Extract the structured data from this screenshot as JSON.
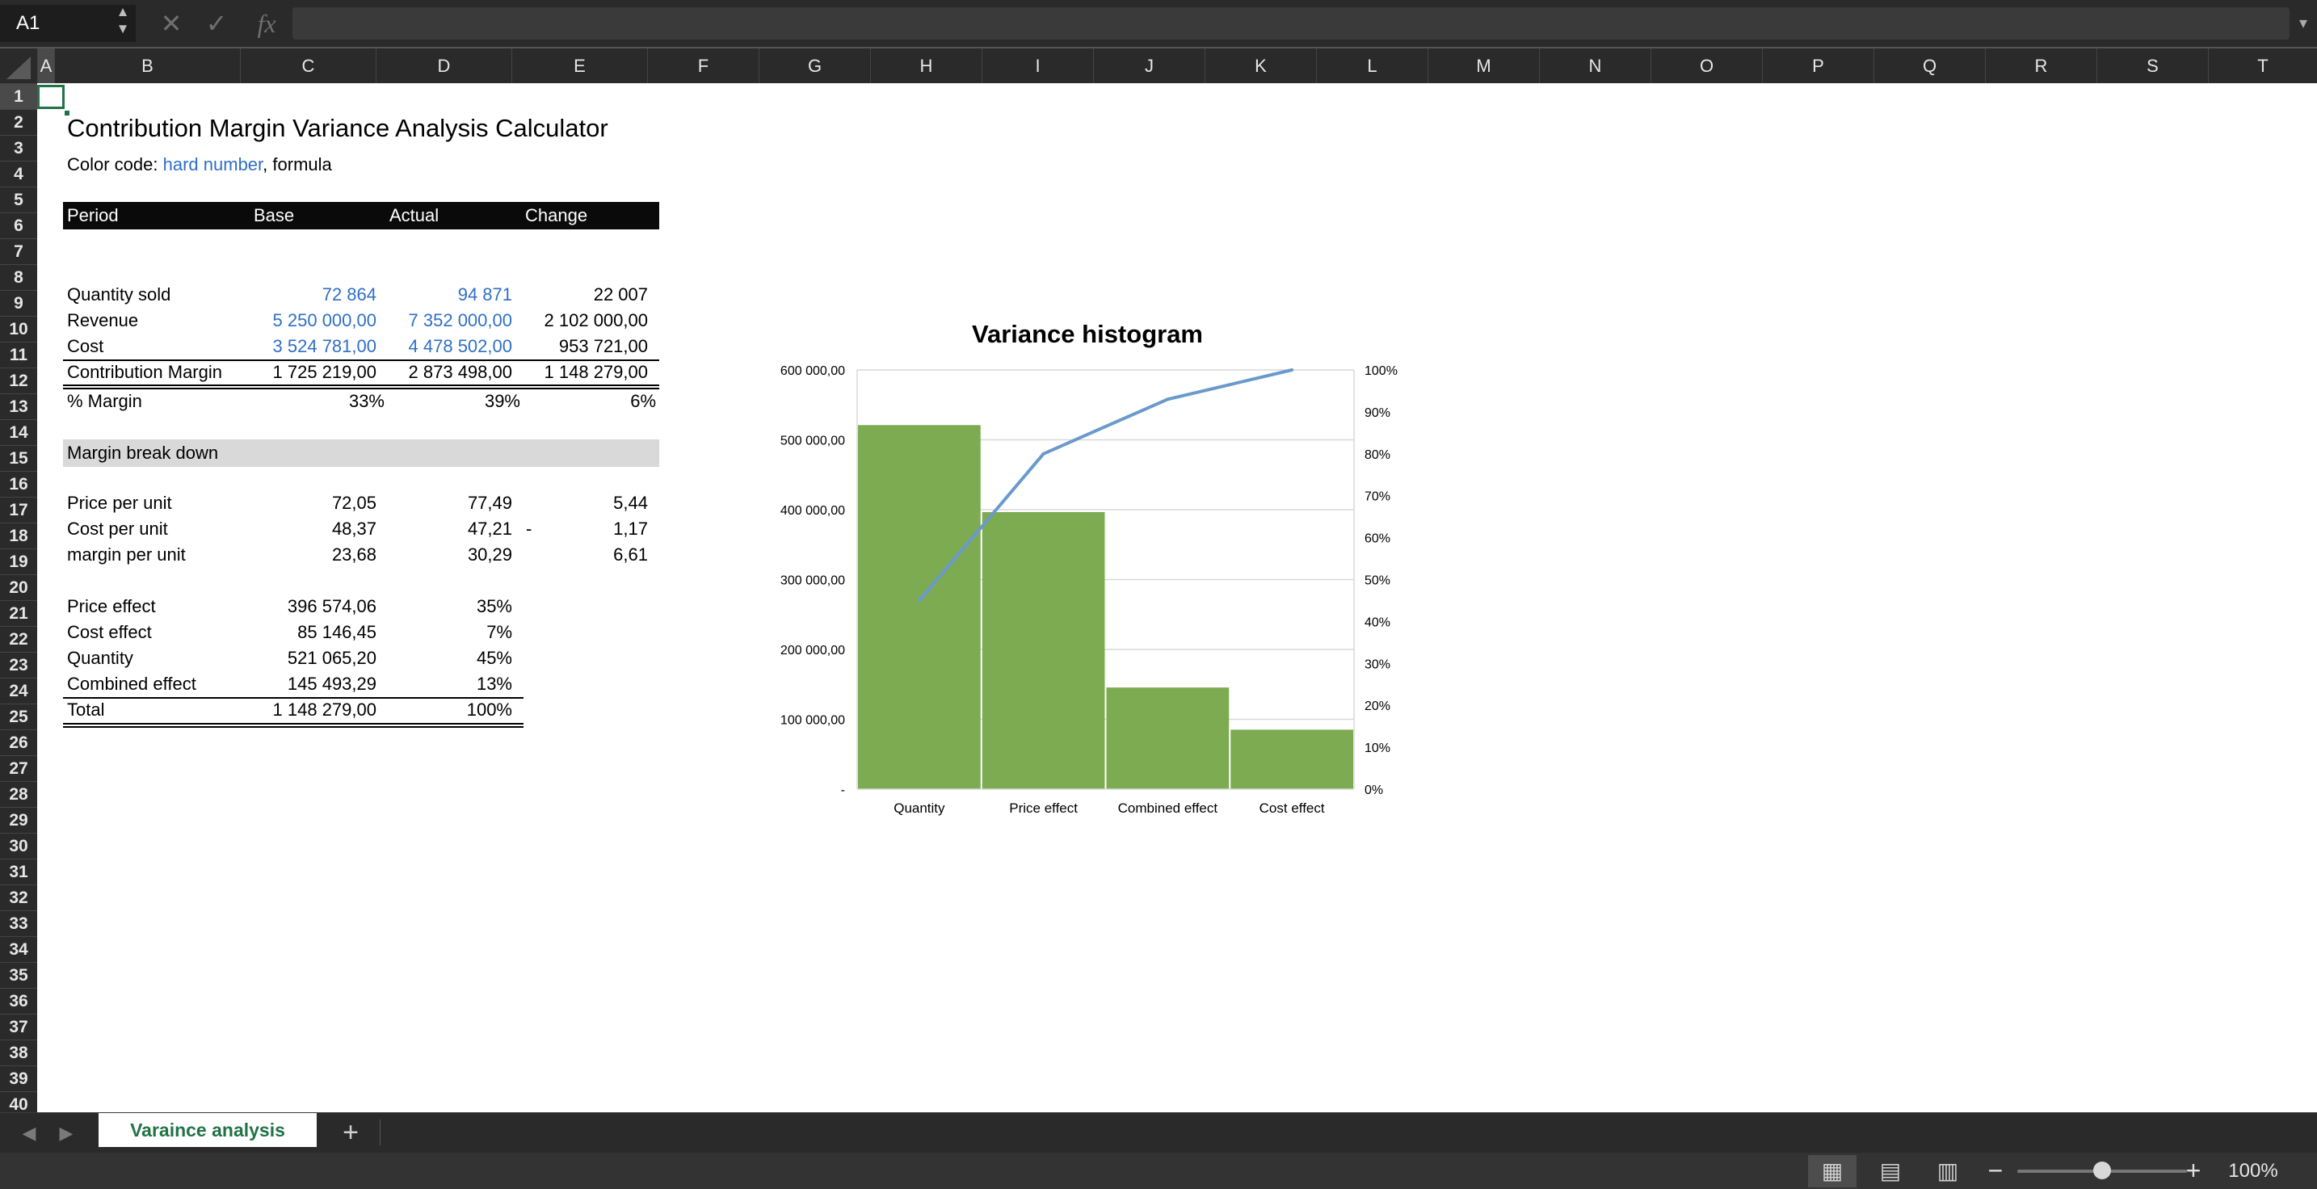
{
  "formula_bar": {
    "name_box": "A1",
    "stepper": "▲▼",
    "cancel_icon": "✕",
    "confirm_icon": "✓",
    "fx_label": "fx",
    "formula": "",
    "expand_icon": "▾"
  },
  "columns": [
    "A",
    "B",
    "C",
    "D",
    "E",
    "F",
    "G",
    "H",
    "I",
    "J",
    "K",
    "L",
    "M",
    "N",
    "O",
    "P",
    "Q",
    "R",
    "S",
    "T"
  ],
  "rows": [
    "1",
    "2",
    "3",
    "4",
    "5",
    "6",
    "7",
    "8",
    "9",
    "10",
    "11",
    "12",
    "13",
    "14",
    "15",
    "16",
    "17",
    "18",
    "19",
    "20",
    "21",
    "22",
    "23",
    "24",
    "25",
    "26",
    "27",
    "28",
    "29",
    "30",
    "31",
    "32",
    "33",
    "34",
    "35",
    "36",
    "37",
    "38",
    "39",
    "40"
  ],
  "sheet": {
    "title": "Contribution Margin Variance Analysis Calculator",
    "color_code": {
      "label": "Color code: ",
      "hard": "hard number",
      "sep": ", ",
      "formula": "formula"
    },
    "header": {
      "period": "Period",
      "base": "Base",
      "actual": "Actual",
      "change": "Change"
    },
    "main_table": [
      {
        "label": "Quantity sold",
        "base": "72 864",
        "actual": "94 871",
        "change": "22 007"
      },
      {
        "label": "Revenue",
        "base": "5 250 000,00",
        "actual": "7 352 000,00",
        "change": "2 102 000,00"
      },
      {
        "label": "Cost",
        "base": "3 524 781,00",
        "actual": "4 478 502,00",
        "change": "953 721,00"
      },
      {
        "label": "Contribution Margin",
        "base": "1 725 219,00",
        "actual": "2 873 498,00",
        "change": "1 148 279,00"
      },
      {
        "label": "% Margin",
        "base": "33%",
        "actual": "39%",
        "change": "6%"
      }
    ],
    "breakdown_label": "Margin break down",
    "per_unit": [
      {
        "label": "Price per unit",
        "base": "72,05",
        "actual": "77,49",
        "sign": "",
        "change": "5,44"
      },
      {
        "label": "Cost per unit",
        "base": "48,37",
        "actual": "47,21",
        "sign": "-",
        "change": "1,17"
      },
      {
        "label": "margin per unit",
        "base": "23,68",
        "actual": "30,29",
        "sign": "",
        "change": "6,61"
      }
    ],
    "effects": [
      {
        "label": "Price effect",
        "value": "396 574,06",
        "pct": "35%"
      },
      {
        "label": "Cost effect",
        "value": "85 146,45",
        "pct": "7%"
      },
      {
        "label": "Quantity",
        "value": "521 065,20",
        "pct": "45%"
      },
      {
        "label": "Combined effect",
        "value": "145 493,29",
        "pct": "13%"
      },
      {
        "label": "Total",
        "value": "1 148 279,00",
        "pct": "100%"
      }
    ]
  },
  "chart_data": {
    "type": "bar",
    "title": "Variance histogram",
    "categories": [
      "Quantity",
      "Price effect",
      "Combined effect",
      "Cost effect"
    ],
    "series": [
      {
        "type": "bar",
        "values": [
          521065.2,
          396574.06,
          145493.29,
          85146.45
        ],
        "color": "#7dab52"
      },
      {
        "type": "line",
        "axis": "secondary",
        "values": [
          0.45,
          0.8,
          0.93,
          1.0
        ],
        "color": "#6a9acb"
      }
    ],
    "ylim": [
      0,
      600000
    ],
    "y_ticks": [
      "-",
      "100 000,00",
      "200 000,00",
      "300 000,00",
      "400 000,00",
      "500 000,00",
      "600 000,00"
    ],
    "y2lim": [
      0,
      1
    ],
    "y2_ticks": [
      "0%",
      "10%",
      "20%",
      "30%",
      "40%",
      "50%",
      "60%",
      "70%",
      "80%",
      "90%",
      "100%"
    ],
    "grid": true
  },
  "tabs": {
    "prev": "◀",
    "next": "▶",
    "active": "Varaince analysis",
    "add": "+"
  },
  "status": {
    "zoom_minus": "−",
    "zoom_plus": "+",
    "zoom_value": 0.5,
    "zoom_label": "100%",
    "view_normal": "▦",
    "view_layout": "▤",
    "view_break": "▥"
  }
}
